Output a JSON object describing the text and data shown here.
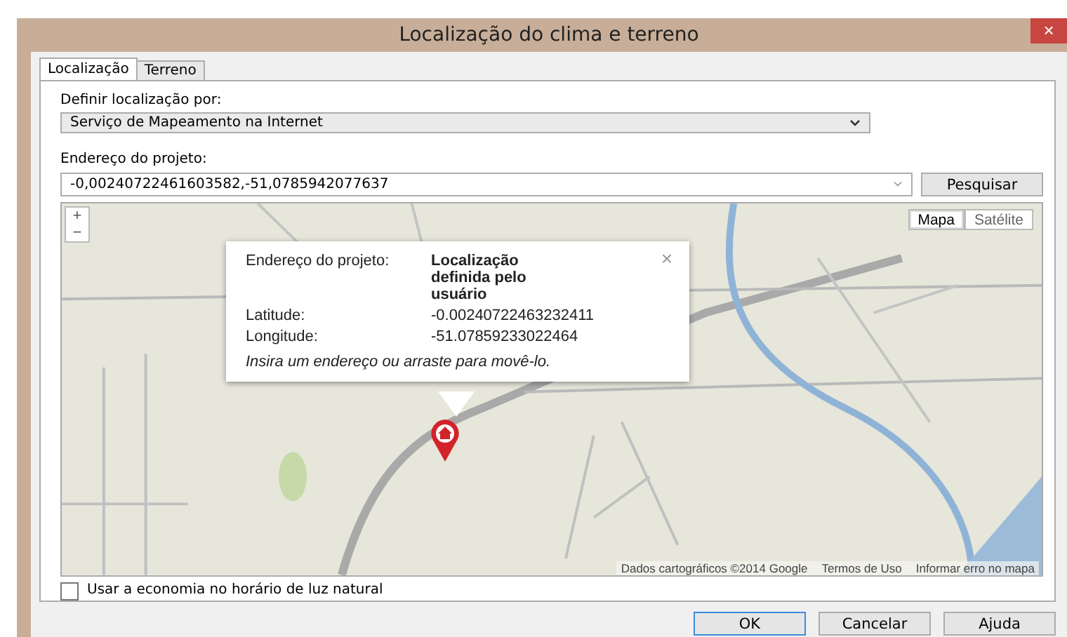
{
  "window": {
    "title": "Localização do clima e terreno",
    "close": "×"
  },
  "tabs": [
    {
      "label": "Localização",
      "selected": true
    },
    {
      "label": "Terreno",
      "selected": false
    }
  ],
  "location_method": {
    "label": "Definir localização por:",
    "value": "Serviço de Mapeamento na Internet"
  },
  "address": {
    "label": "Endereço do projeto:",
    "value": "-0,00240722461603582,-51,0785942077637",
    "search_button": "Pesquisar"
  },
  "map": {
    "zoom_in": "+",
    "zoom_out": "−",
    "map_types": [
      {
        "label": "Mapa",
        "selected": true
      },
      {
        "label": "Satélite",
        "selected": false
      }
    ],
    "popup": {
      "address_label": "Endereço do projeto:",
      "address_value": "Localização definida pelo usuário",
      "close": "×",
      "rows": [
        {
          "label": "Latitude:",
          "value": "-0.00240722463232411"
        },
        {
          "label": "Longitude:",
          "value": "-51.07859233022464"
        }
      ],
      "hint": "Insira um endereço ou arraste para movê-lo."
    },
    "attribution": "Dados cartográficos ©2014 Google",
    "terms": "Termos de Uso",
    "report": "Informar erro no mapa"
  },
  "daylight_saving": {
    "label": "Usar a economia no horário de luz natural",
    "checked": false
  },
  "buttons": [
    {
      "label": "OK",
      "default": true
    },
    {
      "label": "Cancelar",
      "default": false
    },
    {
      "label": "Ajuda",
      "default": false
    }
  ]
}
